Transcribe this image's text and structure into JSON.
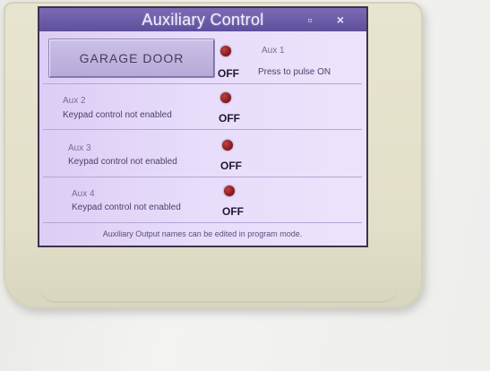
{
  "window": {
    "title": "Auxiliary Control"
  },
  "titlebar": {
    "minimize_icon": "minimize-icon",
    "close_icon": "close-icon",
    "close_glyph": "×",
    "minimize_glyph": "▫"
  },
  "garage_button": {
    "label": "GARAGE DOOR"
  },
  "aux_rows": [
    {
      "name": "Aux 1",
      "description": "Press to pulse ON",
      "state": "OFF",
      "led_color": "#8b1a1f"
    },
    {
      "name": "Aux 2",
      "description": "Keypad control not enabled",
      "state": "OFF",
      "led_color": "#8b1a1f"
    },
    {
      "name": "Aux 3",
      "description": "Keypad control not enabled",
      "state": "OFF",
      "led_color": "#8b1a1f"
    },
    {
      "name": "Aux 4",
      "description": "Keypad control not enabled",
      "state": "OFF",
      "led_color": "#8b1a1f"
    }
  ],
  "footer": {
    "note": "Auxiliary Output names can be edited in program mode."
  },
  "colors": {
    "titlebar": "#6a5aa8",
    "panel": "#e3d6f8",
    "text": "#4c3f6a"
  }
}
